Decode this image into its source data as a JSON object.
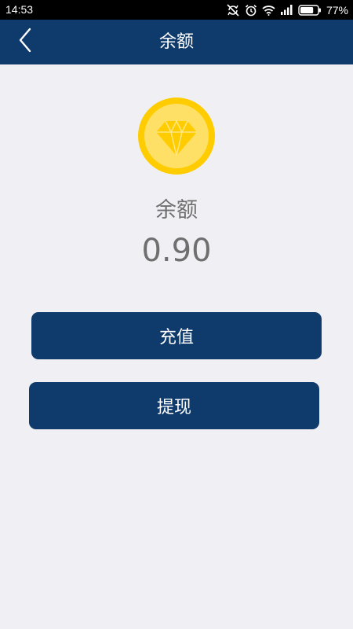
{
  "status_bar": {
    "time": "14:53",
    "battery_percent": "77%",
    "battery_level": 0.77,
    "icons": [
      "sync-off-icon",
      "alarm-icon",
      "wifi-icon",
      "signal-icon",
      "battery-icon"
    ]
  },
  "nav": {
    "title": "余额",
    "back_icon": "chevron-left-icon"
  },
  "balance": {
    "icon": "diamond-coin-icon",
    "label": "余额",
    "value": "0.90"
  },
  "actions": {
    "recharge_label": "充值",
    "withdraw_label": "提现"
  },
  "colors": {
    "header": "#0e3a6c",
    "button": "#0e3a6c",
    "background": "#efeff4",
    "text_gray": "#6f6f6f",
    "coin_outer": "#ffcc00",
    "coin_inner": "#ffe066",
    "status_bar": "#000000"
  }
}
